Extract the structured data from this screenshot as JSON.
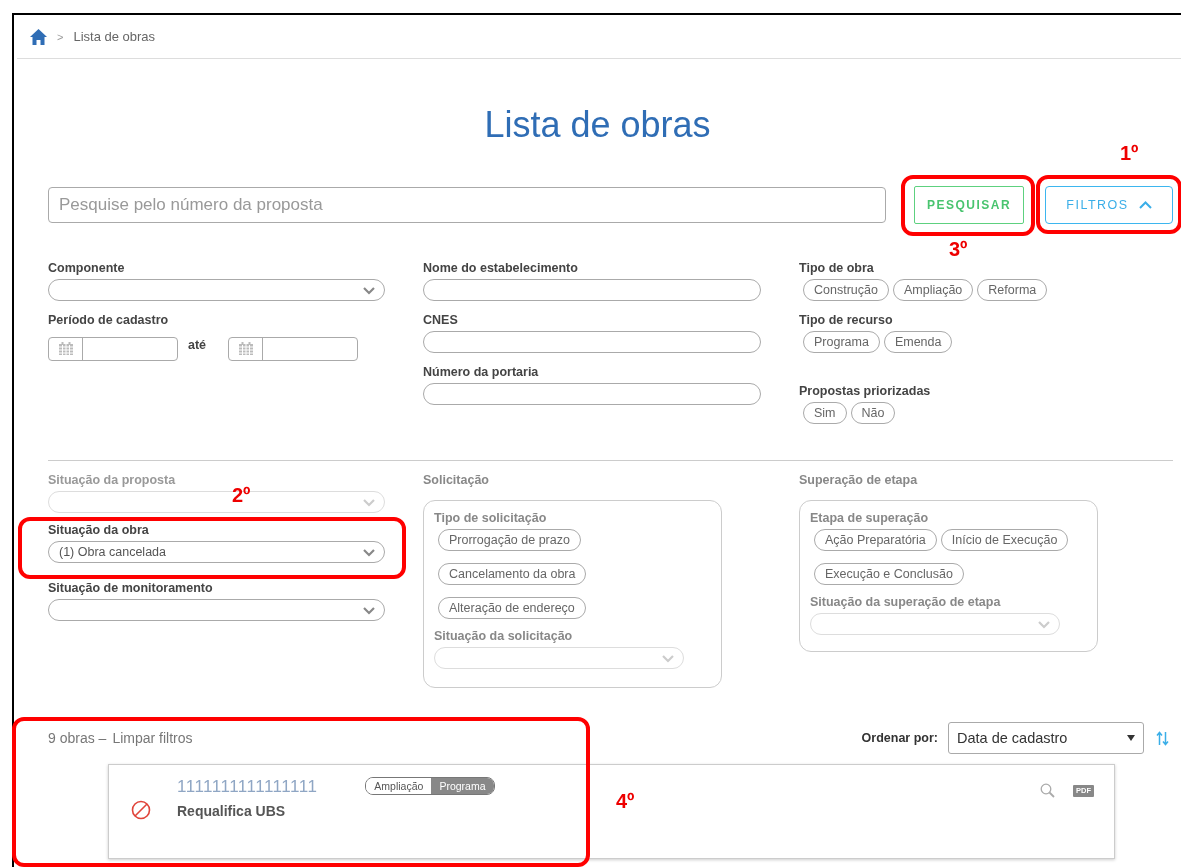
{
  "breadcrumb": {
    "separator": ">",
    "current": "Lista de obras"
  },
  "title": "Lista de obras",
  "search": {
    "placeholder": "Pesquise pelo número da proposta"
  },
  "buttons": {
    "search": "PESQUISAR",
    "filters": "FILTROS",
    "filters_expanded": true
  },
  "filters": {
    "componente": {
      "label": "Componente"
    },
    "periodo": {
      "label": "Período de cadastro",
      "separator": "até"
    },
    "nome": {
      "label": "Nome do estabelecimento"
    },
    "cnes": {
      "label": "CNES"
    },
    "portaria": {
      "label": "Número da portaria"
    },
    "tipo_obra": {
      "label": "Tipo de obra",
      "options": [
        {
          "label": "Construção",
          "selected": false
        },
        {
          "label": "Ampliação",
          "selected": false
        },
        {
          "label": "Reforma",
          "selected": false
        }
      ]
    },
    "tipo_recurso": {
      "label": "Tipo de recurso",
      "options": [
        {
          "label": "Programa",
          "selected": false
        },
        {
          "label": "Emenda",
          "selected": false
        }
      ]
    },
    "priorizadas": {
      "label": "Propostas priorizadas",
      "options": [
        {
          "label": "Sim",
          "selected": false
        },
        {
          "label": "Não",
          "selected": false
        }
      ]
    }
  },
  "status_filters": [
    {
      "label": "Situação da proposta",
      "disabled": true
    },
    {
      "label": "Situação da obra",
      "value": "(1) Obra cancelada",
      "disabled": false
    },
    {
      "label": "Situação de monitoramento",
      "disabled": false
    }
  ],
  "solicitacao": {
    "title": "Solicitação",
    "type_label": "Tipo de solicitação",
    "options": [
      {
        "label": "Prorrogação de prazo",
        "selected": false
      },
      {
        "label": "Cancelamento da obra",
        "selected": false
      },
      {
        "label": "Alteração de endereço",
        "selected": false
      }
    ],
    "status_label": "Situação da solicitação"
  },
  "superacao": {
    "title": "Superação de etapa",
    "type_label": "Etapa de superação",
    "options": [
      {
        "label": "Ação Preparatória",
        "selected": false
      },
      {
        "label": "Início de Execução",
        "selected": false
      },
      {
        "label": "Execução e Conclusão",
        "selected": false
      }
    ],
    "status_label": "Situação da superação de etapa"
  },
  "results": {
    "count": "9 obras –",
    "clear": "Limpar filtros",
    "sort_label": "Ordenar por:",
    "sort_value": "Data de cadastro"
  },
  "cards": [
    {
      "number": "1111111111111111",
      "name": "Requalifica UBS",
      "tags": [
        {
          "label": "Ampliação",
          "kind": "type"
        },
        {
          "label": "Programa",
          "kind": "resource"
        }
      ],
      "pdf": "PDF"
    }
  ],
  "annotations": [
    {
      "label": "1º"
    },
    {
      "label": "2º"
    },
    {
      "label": "3º"
    },
    {
      "label": "4º"
    }
  ]
}
